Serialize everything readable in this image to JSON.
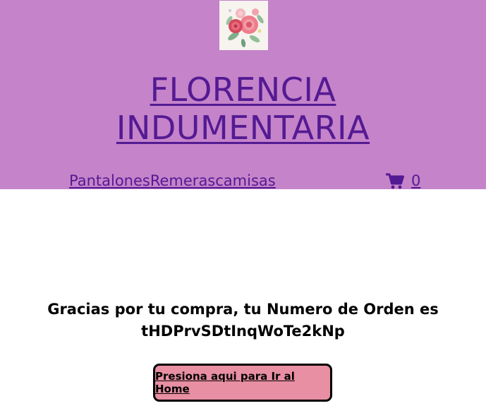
{
  "header": {
    "logo_icon": "flower-bouquet-logo",
    "brand_line1": "FLORENCIA",
    "brand_line2": "INDUMENTARIA",
    "background": "#c583c9",
    "brand_color": "#541a93"
  },
  "nav": {
    "items": [
      {
        "label": "Pantalones"
      },
      {
        "label": "Remeras"
      },
      {
        "label": "camisas"
      }
    ]
  },
  "cart": {
    "icon": "shopping-cart-icon",
    "count": "0"
  },
  "main": {
    "message_line1": "Gracias por tu compra, tu Numero de Orden es",
    "message_line2": "tHDPrvSDtInqWoTe2kNp",
    "home_button_label": "Presiona aqui para Ir al Home",
    "button_color": "#e88fa3"
  }
}
